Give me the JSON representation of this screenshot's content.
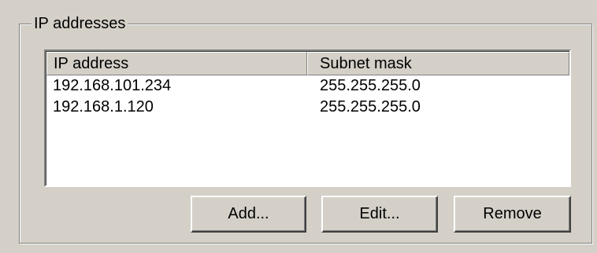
{
  "group": {
    "title": "IP addresses"
  },
  "table": {
    "columns": [
      "IP address",
      "Subnet mask"
    ],
    "rows": [
      [
        "192.168.101.234",
        "255.255.255.0"
      ],
      [
        "192.168.1.120",
        "255.255.255.0"
      ]
    ]
  },
  "buttons": {
    "add": "Add...",
    "edit": "Edit...",
    "remove": "Remove"
  }
}
